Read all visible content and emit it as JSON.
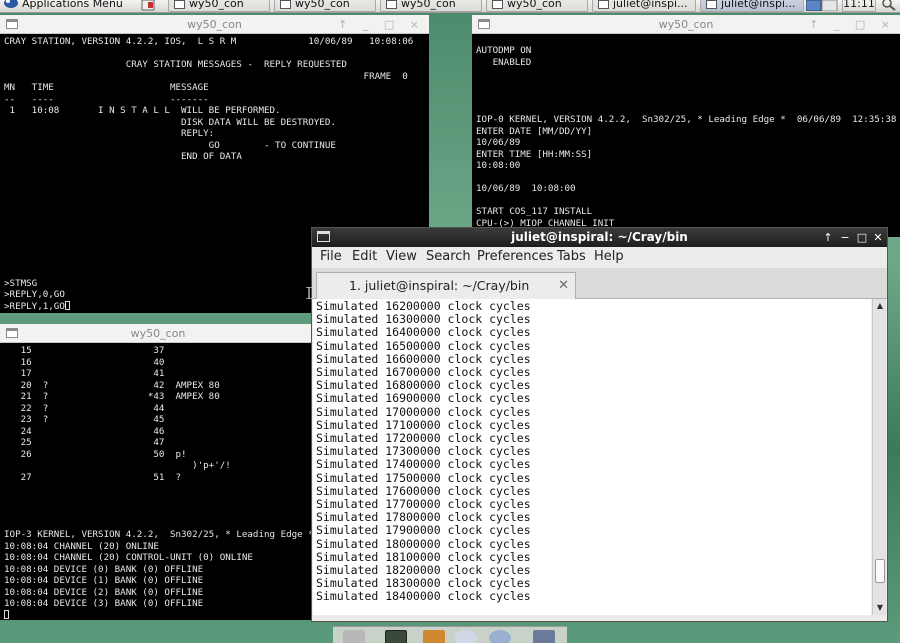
{
  "top_panel": {
    "apps_menu_label": "Applications Menu",
    "tasks": [
      "wy50_con",
      "wy50_con",
      "wy50_con",
      "wy50_con",
      "juliet@inspi...",
      "juliet@inspi..."
    ],
    "clock": "11:11"
  },
  "win1": {
    "title": "wy50_con",
    "lines": [
      "CRAY STATION, VERSION 4.2.2, IOS,  L S R M             10/06/89   10:08:06",
      "",
      "                      CRAY STATION MESSAGES -  REPLY REQUESTED",
      "                                                                 FRAME  0",
      "MN   TIME                     MESSAGE",
      "--   ----                     -------",
      " 1   10:08       I N S T A L L  WILL BE PERFORMED.",
      "                                DISK DATA WILL BE DESTROYED.",
      "                                REPLY:",
      "                                     GO        - TO CONTINUE",
      "                                END OF DATA",
      "",
      "",
      "",
      "",
      "",
      "",
      "",
      "",
      "",
      "",
      ">STMSG",
      ">REPLY,0,GO",
      ">REPLY,1,GO"
    ]
  },
  "win2": {
    "title": "wy50_con",
    "lines": [
      "AUTODMP ON",
      "   ENABLED",
      "",
      "",
      "",
      "",
      "IOP-0 KERNEL, VERSION 4.2.2,  Sn302/25, * Leading Edge *  06/06/89  12:35:38",
      "ENTER DATE [MM/DD/YY]",
      "10/06/89",
      "ENTER TIME [HH:MM:SS]",
      "10:08:00",
      "",
      "10/06/89  10:08:00",
      "",
      "START COS_117 INSTALL",
      "CPU-(>) MIOP CHANNEL INIT"
    ]
  },
  "win3": {
    "title": "wy50_con",
    "lines": [
      "   15                      37",
      "   16                      40",
      "   17                      41",
      "   20  ?                   42  AMPEX 80",
      "   21  ?                  *43  AMPEX 80",
      "   22  ?                   44",
      "   23  ?                   45",
      "   24                      46",
      "   25                      47",
      "   26                      50  p!",
      "                                  )'p+'/!",
      "   27                      51  ?",
      "",
      "",
      "",
      "",
      "IOP-3 KERNEL, VERSION 4.2.2,  Sn302/25, * Leading Edge *",
      "10:08:04 CHANNEL (20) ONLINE",
      "10:08:04 CHANNEL (20) CONTROL-UNIT (0) ONLINE",
      "10:08:04 DEVICE (0) BANK (0) OFFLINE",
      "10:08:04 DEVICE (1) BANK (0) OFFLINE",
      "10:08:04 DEVICE (2) BANK (0) OFFLINE",
      "10:08:04 DEVICE (3) BANK (0) OFFLINE"
    ]
  },
  "gterm": {
    "title": "juliet@inspiral: ~/Cray/bin",
    "menu": [
      "File",
      "Edit",
      "View",
      "Search",
      "Preferences",
      "Tabs",
      "Help"
    ],
    "tab_label": "1. juliet@inspiral: ~/Cray/bin",
    "scroll_position": 0.93,
    "lines": [
      "Simulated 16200000 clock cycles",
      "Simulated 16300000 clock cycles",
      "Simulated 16400000 clock cycles",
      "Simulated 16500000 clock cycles",
      "Simulated 16600000 clock cycles",
      "Simulated 16700000 clock cycles",
      "Simulated 16800000 clock cycles",
      "Simulated 16900000 clock cycles",
      "Simulated 17000000 clock cycles",
      "Simulated 17100000 clock cycles",
      "Simulated 17200000 clock cycles",
      "Simulated 17300000 clock cycles",
      "Simulated 17400000 clock cycles",
      "Simulated 17500000 clock cycles",
      "Simulated 17600000 clock cycles",
      "Simulated 17700000 clock cycles",
      "Simulated 17800000 clock cycles",
      "Simulated 17900000 clock cycles",
      "Simulated 18000000 clock cycles",
      "Simulated 18100000 clock cycles",
      "Simulated 18200000 clock cycles",
      "Simulated 18300000 clock cycles",
      "Simulated 18400000 clock cycles"
    ]
  },
  "colors": {
    "terminal_bg": "#000000",
    "terminal_fg": "#e8e8e8",
    "gterm_title_bg": "#2a2a2a",
    "desktop": "#5c9a7c"
  }
}
